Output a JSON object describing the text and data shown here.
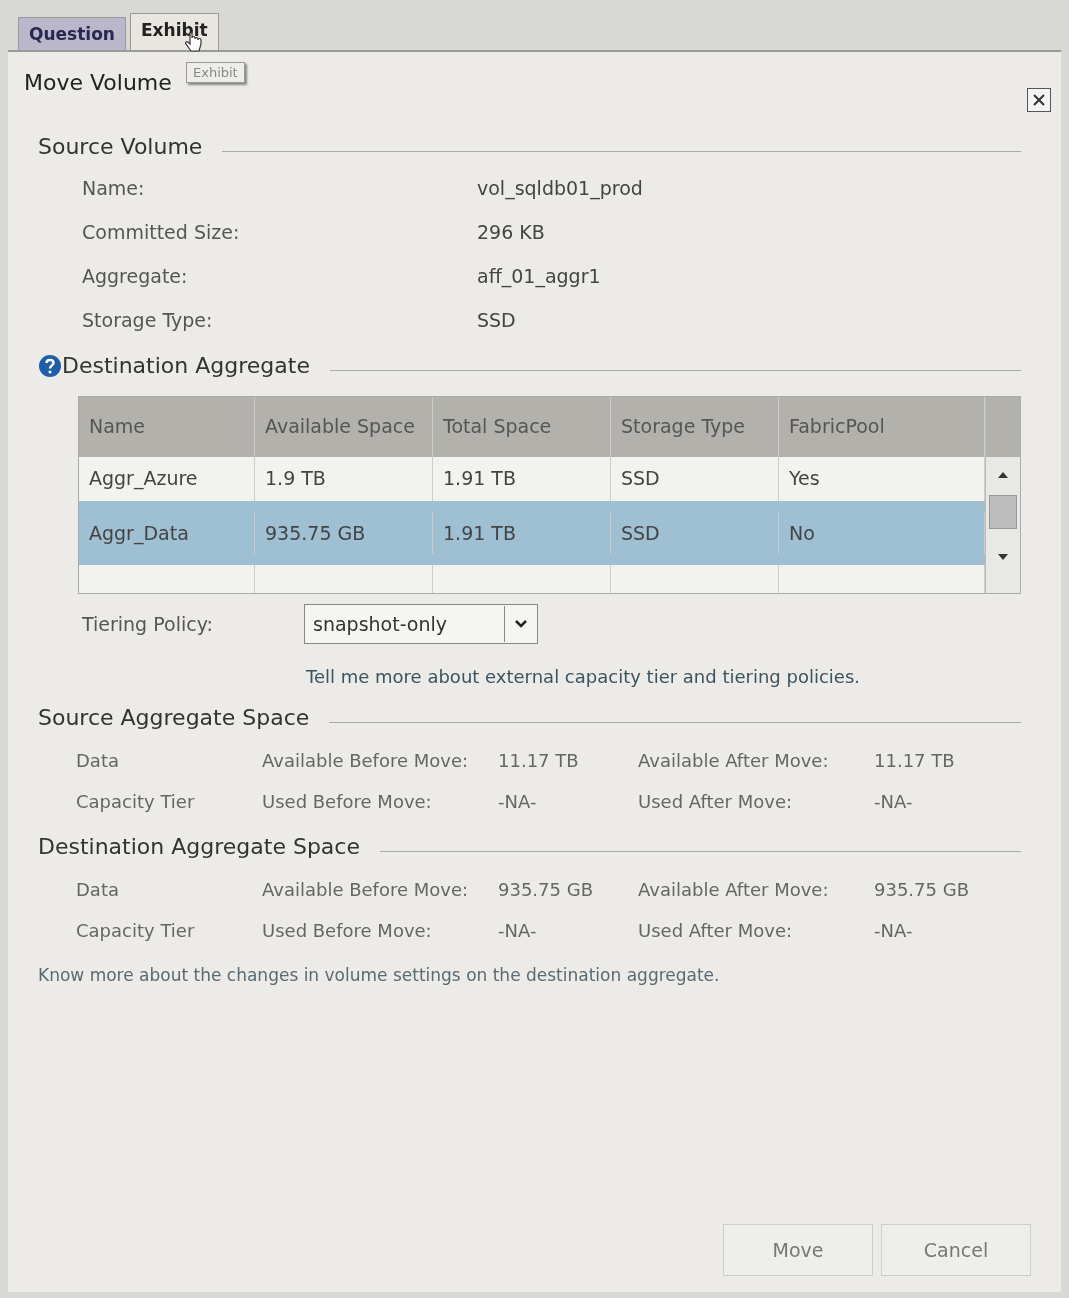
{
  "tabs": [
    {
      "label": "Question",
      "selected": false
    },
    {
      "label": "Exhibit",
      "selected": true
    }
  ],
  "tooltip": "Exhibit",
  "dialog": {
    "title": "Move Volume"
  },
  "source_volume": {
    "heading": "Source Volume",
    "fields": [
      {
        "label": "Name:",
        "value": "vol_sqldb01_prod"
      },
      {
        "label": "Committed Size:",
        "value": "296 KB"
      },
      {
        "label": "Aggregate:",
        "value": "aff_01_aggr1"
      },
      {
        "label": "Storage Type:",
        "value": "SSD"
      }
    ]
  },
  "destination_aggregate": {
    "heading": "Destination Aggregate",
    "table": {
      "columns": [
        "Name",
        "Available Space",
        "Total Space",
        "Storage Type",
        "FabricPool"
      ],
      "rows": [
        {
          "cells": [
            "Aggr_Azure",
            "1.9 TB",
            "1.91 TB",
            "SSD",
            "Yes"
          ],
          "selected": false
        },
        {
          "cells": [
            "Aggr_Data",
            "935.75 GB",
            "1.91 TB",
            "SSD",
            "No"
          ],
          "selected": true
        }
      ]
    },
    "tiering_policy": {
      "label": "Tiering Policy:",
      "value": "snapshot-only"
    },
    "link": "Tell me more about external capacity tier and tiering policies."
  },
  "spaces": [
    {
      "heading": "Source Aggregate Space",
      "rows": [
        {
          "label": "Data",
          "before_label": "Available Before Move:",
          "before": "11.17 TB",
          "after_label": "Available After Move:",
          "after": "11.17 TB"
        },
        {
          "label": "Capacity Tier",
          "before_label": "Used Before Move:",
          "before": "-NA-",
          "after_label": "Used After Move:",
          "after": "-NA-"
        }
      ]
    },
    {
      "heading": "Destination Aggregate Space",
      "rows": [
        {
          "label": "Data",
          "before_label": "Available Before Move:",
          "before": "935.75 GB",
          "after_label": "Available After Move:",
          "after": "935.75 GB"
        },
        {
          "label": "Capacity Tier",
          "before_label": "Used Before Move:",
          "before": "-NA-",
          "after_label": "Used After Move:",
          "after": "-NA-"
        }
      ]
    }
  ],
  "footer_link": "Know more about the changes in volume settings on the destination aggregate.",
  "buttons": [
    "Move",
    "Cancel"
  ]
}
